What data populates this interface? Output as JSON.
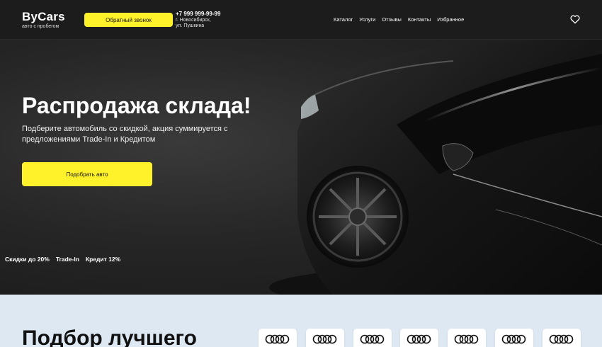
{
  "header": {
    "logo_title": "ByCars",
    "logo_sub": "авто с пробегом",
    "callback_label": "Обратный звонок",
    "phone": "+7 999 999-99-99",
    "address_line1": "г. Новосибирск,",
    "address_line2": "ул. Пушкина",
    "nav": [
      "Каталог",
      "Услуги",
      "Отзывы",
      "Контакты",
      "Избранное"
    ],
    "favorite_icon": "heart-icon"
  },
  "hero": {
    "title": "Распродажа склада!",
    "subtitle": "Подберите автомобиль со скидкой, акция суммируется с предложениями Trade-In и Кредитом",
    "button_label": "Подобрать авто",
    "perks": [
      "Скидки до 20%",
      "Trade-In",
      "Кредит 12%"
    ]
  },
  "section": {
    "title": "Подбор лучшего",
    "brands": [
      "audi-logo",
      "audi-logo",
      "audi-logo",
      "audi-logo",
      "audi-logo",
      "audi-logo",
      "audi-logo"
    ]
  },
  "colors": {
    "accent": "#fff22a",
    "header_bg": "#1c1c1c",
    "section_bg": "#dde8f3"
  }
}
